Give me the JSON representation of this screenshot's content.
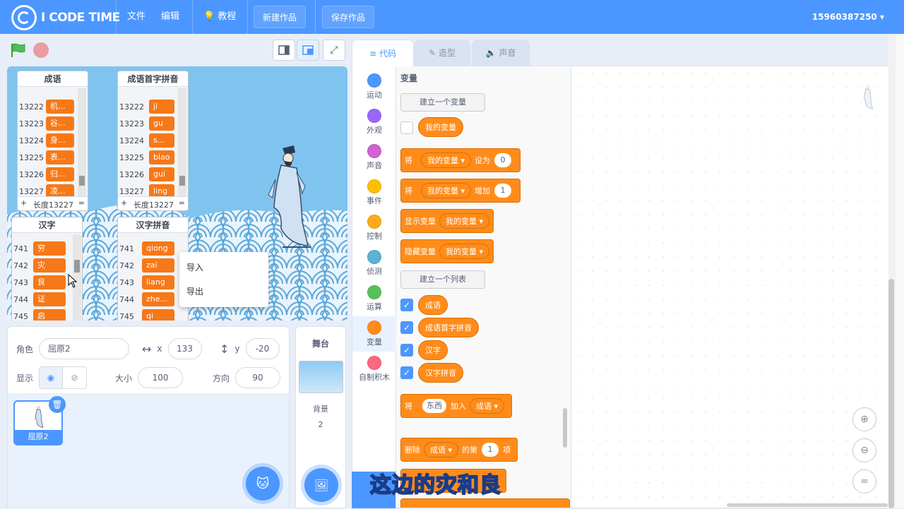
{
  "header": {
    "logo_text": "I CODE TIME",
    "menu": [
      "文件",
      "编辑",
      "教程"
    ],
    "new_project": "新建作品",
    "save_project": "保存作品",
    "user": "15960387250"
  },
  "monitors": {
    "idioms": {
      "title": "成语",
      "length_label": "长度13227",
      "rows": [
        {
          "idx": "13222",
          "val": "机..."
        },
        {
          "idx": "13223",
          "val": "谷..."
        },
        {
          "idx": "13224",
          "val": "身..."
        },
        {
          "idx": "13225",
          "val": "表..."
        },
        {
          "idx": "13226",
          "val": "归..."
        },
        {
          "idx": "13227",
          "val": "凌..."
        }
      ]
    },
    "idiom_pinyin": {
      "title": "成语首字拼音",
      "length_label": "长度13227",
      "rows": [
        {
          "idx": "13222",
          "val": "ji"
        },
        {
          "idx": "13223",
          "val": "gu"
        },
        {
          "idx": "13224",
          "val": "s..."
        },
        {
          "idx": "13225",
          "val": "biao"
        },
        {
          "idx": "13226",
          "val": "gui"
        },
        {
          "idx": "13227",
          "val": "ling"
        }
      ]
    },
    "hanzi": {
      "title": "汉字",
      "rows": [
        {
          "idx": "741",
          "val": "穷"
        },
        {
          "idx": "742",
          "val": "灾"
        },
        {
          "idx": "743",
          "val": "良"
        },
        {
          "idx": "744",
          "val": "证"
        },
        {
          "idx": "745",
          "val": "启"
        }
      ]
    },
    "hanzi_pinyin": {
      "title": "汉字拼音",
      "rows": [
        {
          "idx": "741",
          "val": "qiong"
        },
        {
          "idx": "742",
          "val": "zai"
        },
        {
          "idx": "743",
          "val": "liang"
        },
        {
          "idx": "744",
          "val": "zhe..."
        },
        {
          "idx": "745",
          "val": "qi"
        }
      ]
    }
  },
  "context_menu": {
    "import": "导入",
    "export": "导出"
  },
  "sprite_info": {
    "sprite_label": "角色",
    "sprite_name": "屈原2",
    "x_label": "x",
    "x_value": "133",
    "y_label": "y",
    "y_value": "-20",
    "show_label": "显示",
    "size_label": "大小",
    "size_value": "100",
    "direction_label": "方向",
    "direction_value": "90"
  },
  "sprite_card": {
    "name": "屈原2"
  },
  "stage_panel": {
    "title": "舞台",
    "backdrop_label": "背景",
    "backdrop_count": "2"
  },
  "tabs": {
    "code": "代码",
    "costumes": "造型",
    "sounds": "声音"
  },
  "categories": [
    {
      "label": "运动",
      "color": "#4c97ff"
    },
    {
      "label": "外观",
      "color": "#9966ff"
    },
    {
      "label": "声音",
      "color": "#cf63cf"
    },
    {
      "label": "事件",
      "color": "#ffbf00"
    },
    {
      "label": "控制",
      "color": "#ffab19"
    },
    {
      "label": "侦测",
      "color": "#5cb1d6"
    },
    {
      "label": "运算",
      "color": "#59c059"
    },
    {
      "label": "变量",
      "color": "#ff8c1a"
    },
    {
      "label": "自制积木",
      "color": "#ff6680"
    }
  ],
  "palette": {
    "title": "变量",
    "make_var": "建立一个变量",
    "my_var": "我的变量",
    "set_block": {
      "prefix": "将",
      "var": "我的变量",
      "op": "设为",
      "value": "0"
    },
    "change_block": {
      "prefix": "将",
      "var": "我的变量",
      "op": "增加",
      "value": "1"
    },
    "show_block": {
      "op": "显示变量",
      "var": "我的变量"
    },
    "hide_block": {
      "op": "隐藏变量",
      "var": "我的变量"
    },
    "make_list": "建立一个列表",
    "lists": [
      "成语",
      "成语首字拼音",
      "汉字",
      "汉字拼音"
    ],
    "add_block": {
      "prefix": "将",
      "value": "东西",
      "op": "加入",
      "list": "成语"
    },
    "delete_block": {
      "op": "删除",
      "list": "成语",
      "mid": "的第",
      "value": "1",
      "suffix": "项"
    }
  },
  "subtitle": "这边的灾和良"
}
